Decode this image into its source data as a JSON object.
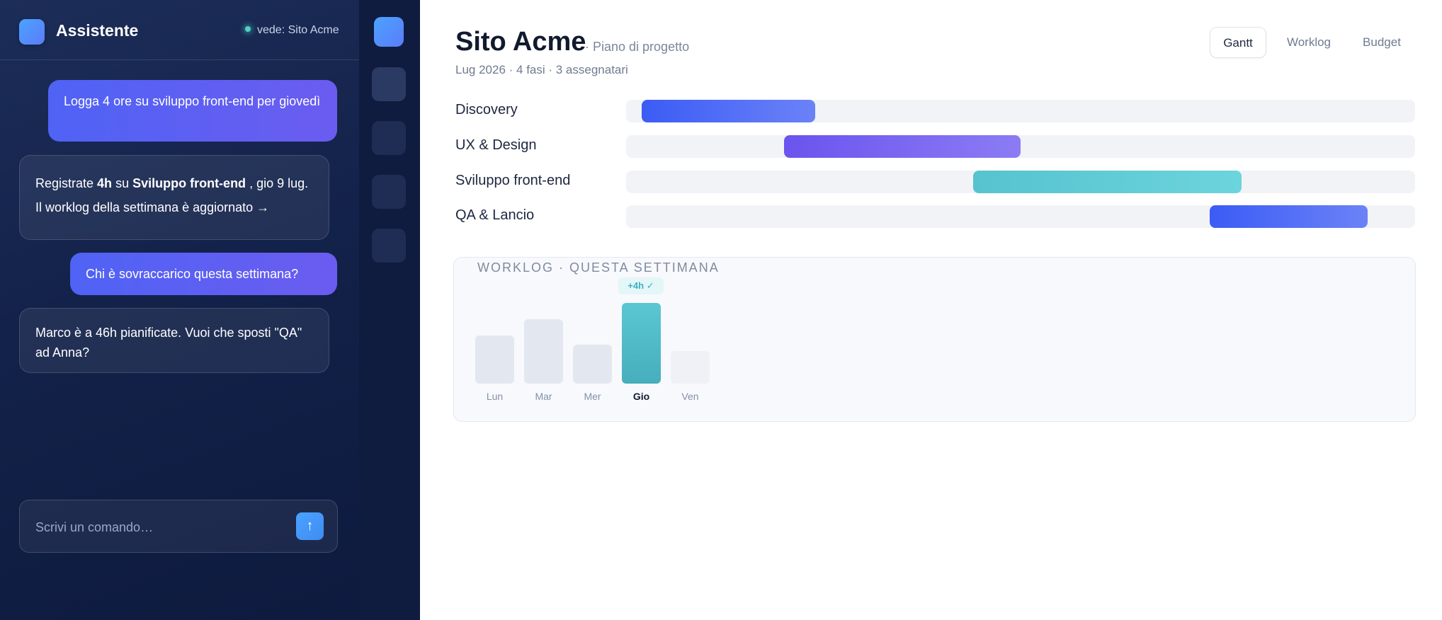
{
  "assistant": {
    "title": "Assistente",
    "context": "vede: Sito Acme",
    "messages": [
      {
        "role": "user",
        "text": "Logga 4 ore su sviluppo front-end per giovedì"
      },
      {
        "role": "assistant",
        "parts": [
          "Registrate ",
          "4h",
          " su ",
          "Sviluppo front-end",
          " , gio 9 lug. Il worklog della settimana è aggiornato →"
        ]
      },
      {
        "role": "user",
        "text": "Chi è sovraccarico questa settimana?"
      },
      {
        "role": "assistant",
        "text": "Marco è a 46h pianificate. Vuoi che sposti \"QA\" ad Anna?"
      }
    ],
    "composer_placeholder": "Scrivi un comando…",
    "send_icon": "↑"
  },
  "rail": {
    "logo_icon": "app-logo-icon",
    "items": [
      "nav-icon-1",
      "nav-icon-2",
      "nav-icon-3",
      "nav-icon-4"
    ]
  },
  "project": {
    "title": "Sito Acme",
    "subtitle": "· Piano di progetto",
    "meta": "Lug 2026 · 4 fasi · 3 assegnatari"
  },
  "tabs": [
    {
      "label": "Gantt",
      "active": true
    },
    {
      "label": "Worklog",
      "active": false
    },
    {
      "label": "Budget",
      "active": false
    }
  ],
  "gantt": {
    "phases": [
      {
        "label": "Discovery",
        "start": 0.02,
        "end": 0.24,
        "color": "#4a63f5"
      },
      {
        "label": "UX & Design",
        "start": 0.2,
        "end": 0.5,
        "color": "#7563f0"
      },
      {
        "label": "Sviluppo front-end",
        "start": 0.44,
        "end": 0.78,
        "color": "#5cc8d3"
      },
      {
        "label": "QA & Lancio",
        "start": 0.74,
        "end": 0.94,
        "color": "#4a63f5"
      }
    ]
  },
  "worklog": {
    "title": "WORKLOG · QUESTA SETTIMANA",
    "highlight_badge": "+4h ✓",
    "days": [
      {
        "label": "Lun",
        "level": 0.6
      },
      {
        "label": "Mar",
        "level": 0.8
      },
      {
        "label": "Mer",
        "level": 0.48
      },
      {
        "label": "Gio",
        "level": 1.0,
        "highlight": true
      },
      {
        "label": "Ven",
        "level": 0.4,
        "future": true
      }
    ]
  },
  "colors": {
    "accent": "#4f63f5",
    "teal": "#5cc8d3",
    "sidebar_bg": "#13224a"
  }
}
